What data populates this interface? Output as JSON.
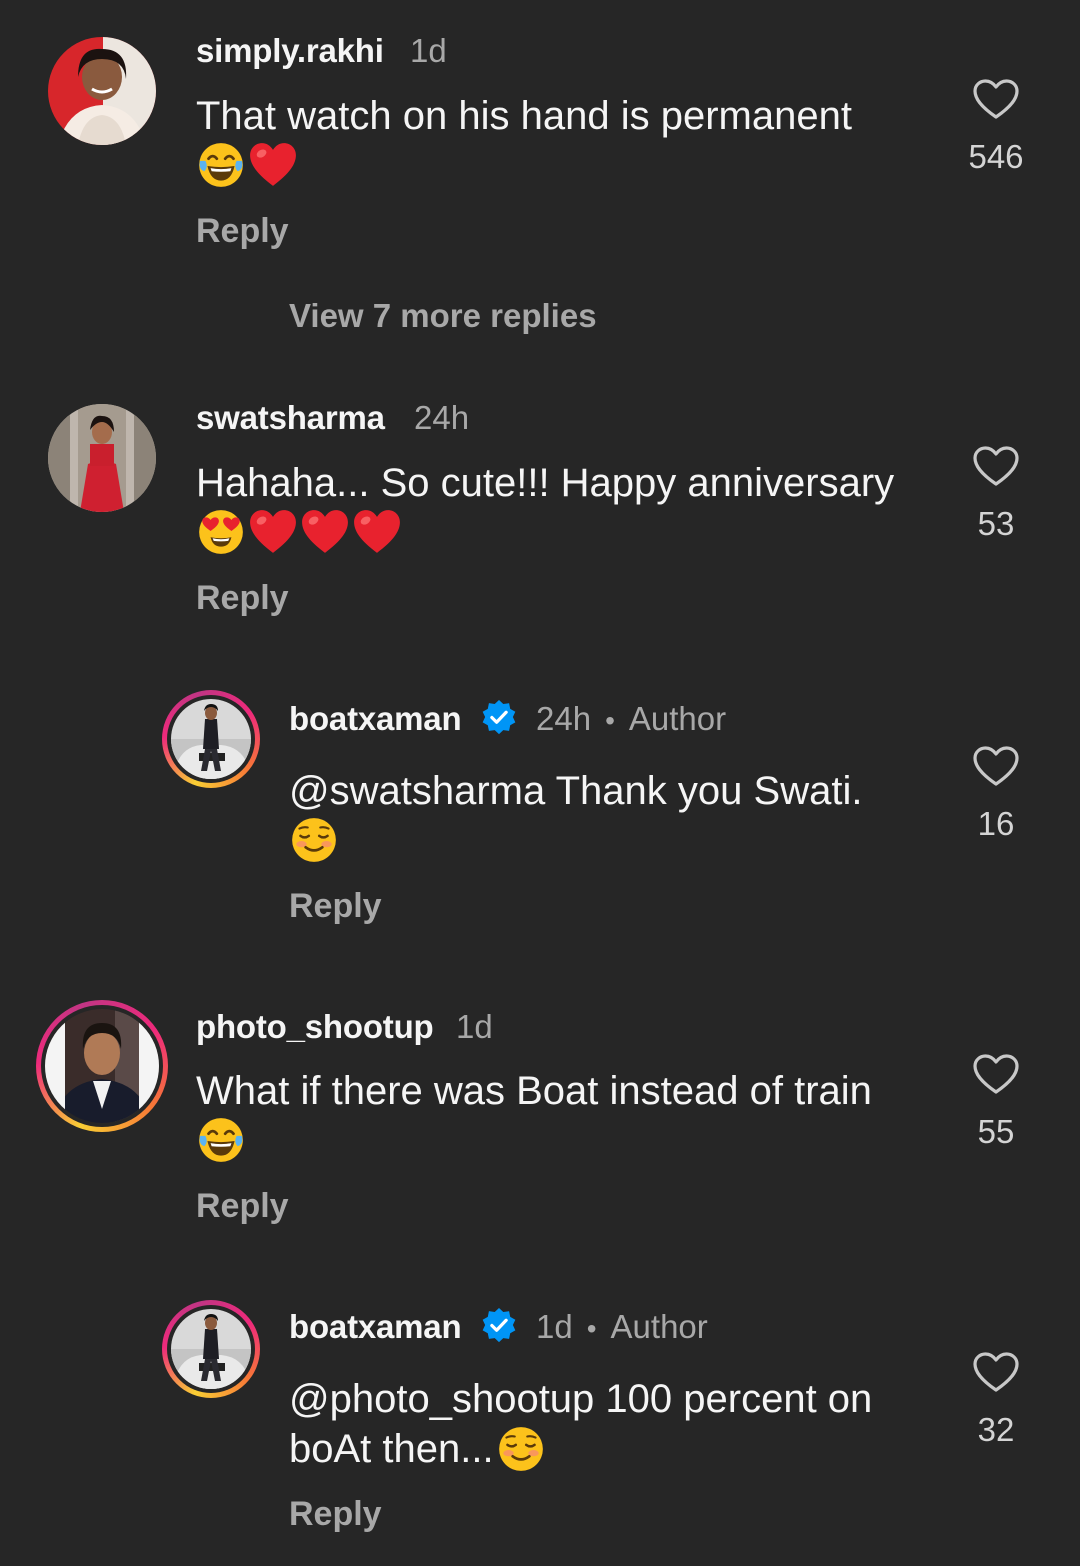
{
  "comments": [
    {
      "username": "simply.rakhi",
      "time": "1d",
      "text": "That watch on his hand is permanent",
      "emojis": [
        "laugh-tears",
        "red-heart"
      ],
      "reply_label": "Reply",
      "likes": "546",
      "avatar": "simply.rakhi avatar"
    },
    {
      "username": "swatsharma",
      "time": "24h",
      "text": "Hahaha... So cute!!! Happy anniversary",
      "emojis": [
        "heart-eyes",
        "red-heart",
        "red-heart",
        "red-heart"
      ],
      "reply_label": "Reply",
      "likes": "53"
    },
    {
      "username": "boatxaman",
      "time": "24h",
      "author_label": "Author",
      "text": "@swatsharma Thank you Swati.",
      "emojis": [
        "smiling-blush"
      ],
      "reply_label": "Reply",
      "likes": "16"
    },
    {
      "username": "photo_shootup",
      "time": "1d",
      "text": "What if there was Boat instead of train",
      "emojis": [
        "laugh-tears"
      ],
      "reply_label": "Reply",
      "likes": "55"
    },
    {
      "username": "boatxaman",
      "time": "1d",
      "author_label": "Author",
      "text_line1": "@photo_shootup 100 percent on",
      "text_line2": "boAt then...",
      "emojis": [
        "smiling-blush"
      ],
      "reply_label": "Reply",
      "likes": "32"
    }
  ],
  "view_more_replies": "View 7 more replies",
  "separator": "•",
  "colors": {
    "background": "#262626",
    "text": "#f5f5f5",
    "muted": "#a8a8a8",
    "verified": "#0095f6"
  }
}
